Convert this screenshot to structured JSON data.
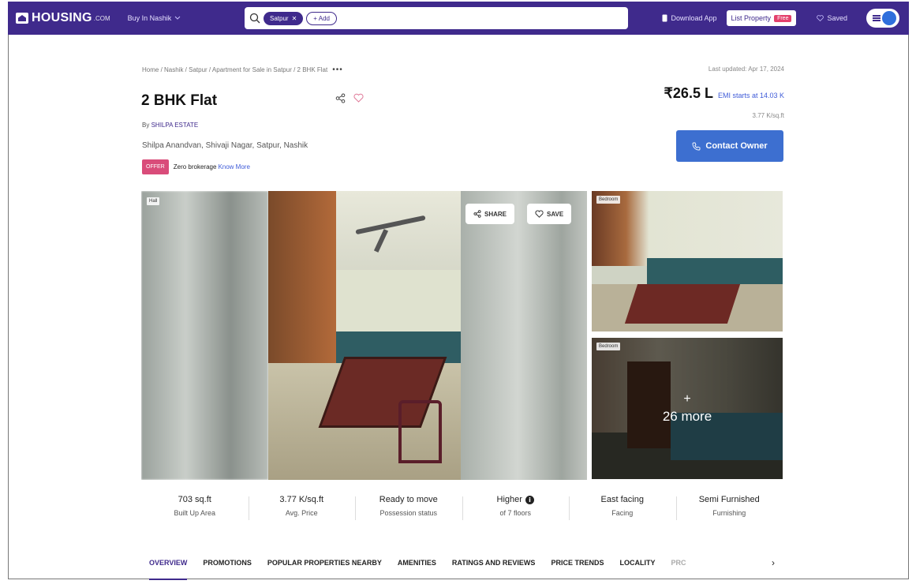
{
  "nav": {
    "logo": "HOUSING",
    "logo_suffix": ".COM",
    "city": "Buy In Nashik",
    "search_chip": "Satpur",
    "add_chip": "+ Add",
    "download_app": "Download App",
    "list_property": "List Property",
    "free_badge": "Free",
    "saved": "Saved"
  },
  "breadcrumb": {
    "path": "Home / Nashik / Satpur / Apartment for Sale in Satpur / 2 BHK Flat",
    "more": "•••",
    "last_updated": "Last updated: Apr 17, 2024"
  },
  "property": {
    "title": "2 BHK Flat",
    "by_prefix": "By",
    "agent": "SHILPA ESTATE",
    "address": "Shilpa Anandvan, Shivaji Nagar, Satpur, Nashik",
    "offer_tag": "OFFER",
    "offer_text": "Zero brokerage",
    "know_more": "Know More"
  },
  "pricing": {
    "price": "₹26.5 L",
    "emi": "EMI starts at 14.03 K",
    "per_sqft": "3.77 K/sq.ft",
    "contact_button": "Contact Owner"
  },
  "gallery": {
    "main_tag": "Hall",
    "share": "SHARE",
    "save": "SAVE",
    "thumb1_tag": "Bedroom",
    "thumb2_tag": "Bedroom",
    "more_plus": "+",
    "more_text": "26 more"
  },
  "stats": [
    {
      "value": "703 sq.ft",
      "label": "Built Up Area"
    },
    {
      "value": "3.77 K/sq.ft",
      "label": "Avg. Price"
    },
    {
      "value": "Ready to move",
      "label": "Possession status"
    },
    {
      "value": "Higher",
      "label": "of 7 floors"
    },
    {
      "value": "East facing",
      "label": "Facing"
    },
    {
      "value": "Semi Furnished",
      "label": "Furnishing"
    }
  ],
  "tabs": [
    "OVERVIEW",
    "PROMOTIONS",
    "POPULAR PROPERTIES NEARBY",
    "AMENITIES",
    "RATINGS AND REVIEWS",
    "PRICE TRENDS",
    "LOCALITY",
    "PRC"
  ],
  "tab_next": "›",
  "colors": {
    "brand": "#3f2a8c",
    "contact": "#3d6fd0",
    "offer": "#d94c7a"
  }
}
